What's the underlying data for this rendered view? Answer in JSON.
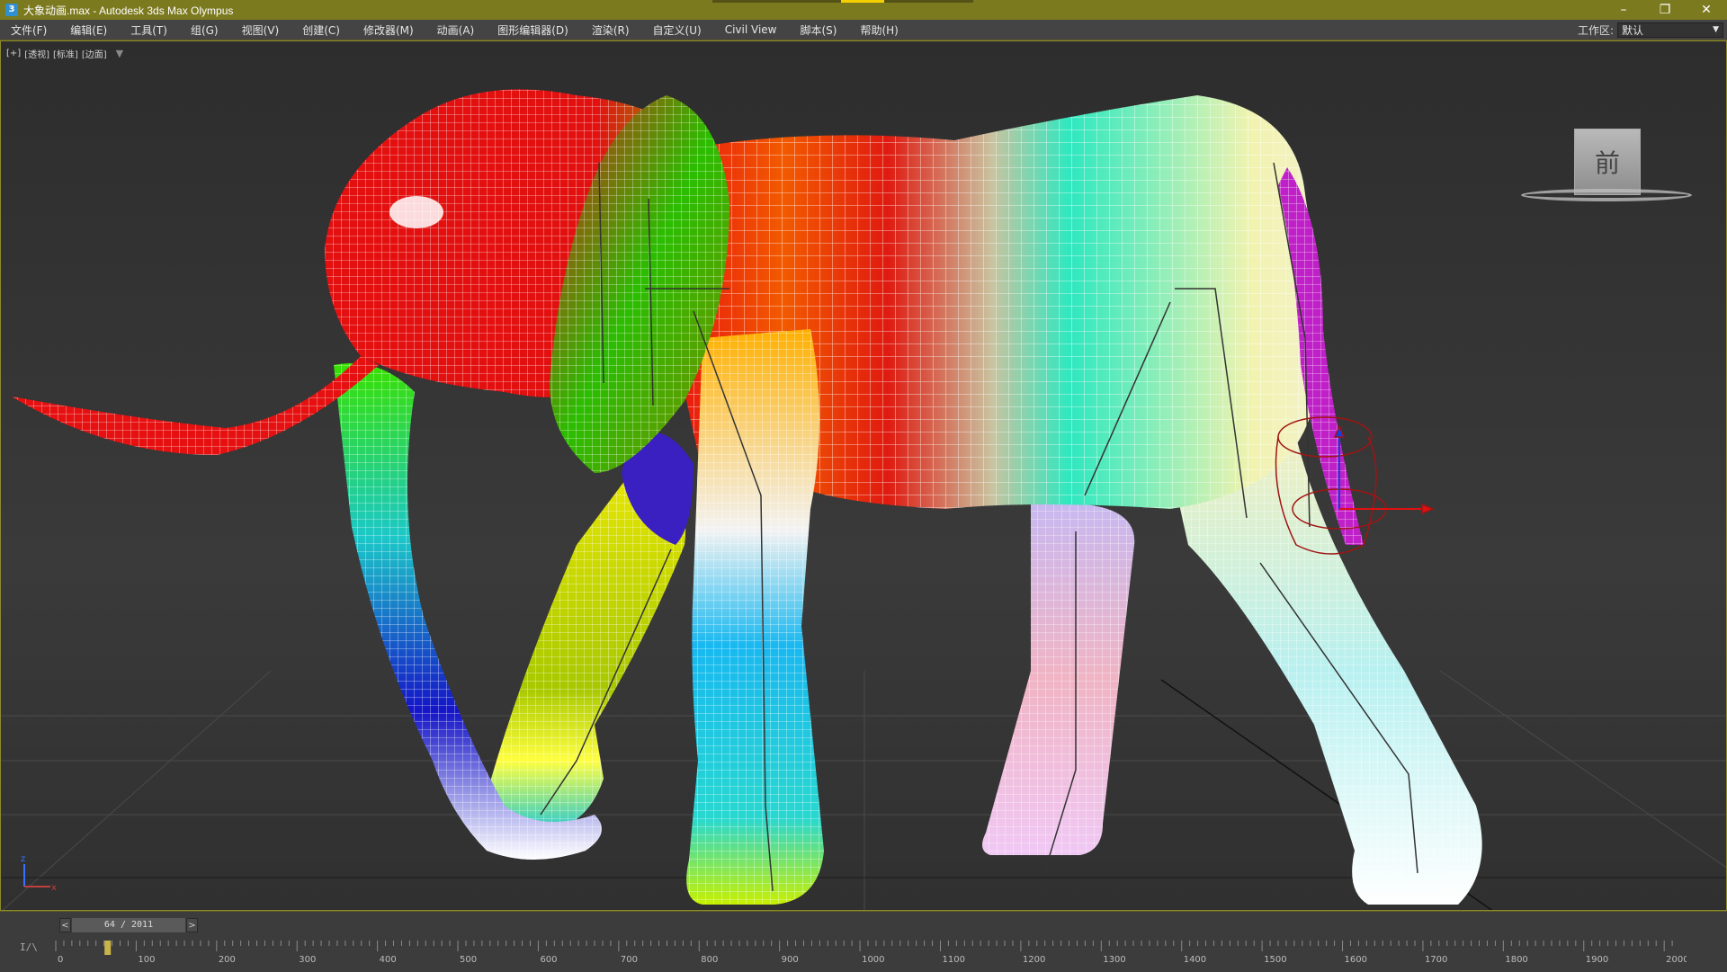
{
  "window": {
    "title": "大象动画.max - Autodesk 3ds Max Olympus",
    "app_icon": "3ds-max-icon",
    "controls": {
      "minimize": "–",
      "restore": "❐",
      "close": "✕"
    }
  },
  "menu": [
    "文件(F)",
    "编辑(E)",
    "工具(T)",
    "组(G)",
    "视图(V)",
    "创建(C)",
    "修改器(M)",
    "动画(A)",
    "图形编辑器(D)",
    "渲染(R)",
    "自定义(U)",
    "Civil View",
    "脚本(S)",
    "帮助(H)"
  ],
  "workspace": {
    "label": "工作区:",
    "value": "默认"
  },
  "viewport": {
    "labels": [
      "[+]",
      "[透视]",
      "[标准]",
      "[边面]"
    ],
    "viewcube_face": "前",
    "axis": {
      "z": "z",
      "x": "x"
    }
  },
  "timeline": {
    "frame_display": "64 / 2011",
    "current_frame": 64,
    "total_frames": 2011,
    "ticks": [
      "0",
      "100",
      "200",
      "300",
      "400",
      "500",
      "600",
      "700",
      "800",
      "900",
      "1000",
      "1100",
      "1200",
      "1300",
      "1400",
      "1500",
      "1600",
      "1700",
      "1800",
      "1900",
      "2000"
    ],
    "track_icon": "I/\\"
  },
  "colors": {
    "titlebar": "#7c7a1f",
    "frame_border": "#8d8b2d",
    "time_slider_marker": "#c9b44a"
  }
}
